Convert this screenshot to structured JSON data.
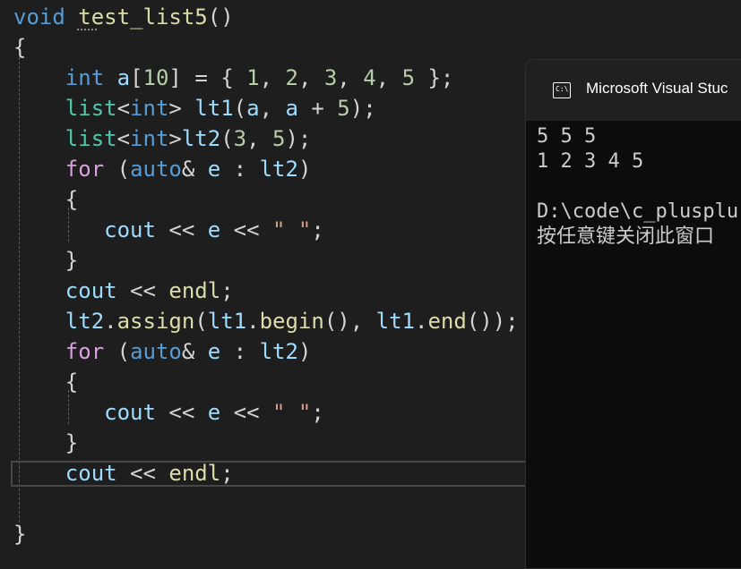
{
  "editor": {
    "lines": [
      {
        "id": "l1",
        "tokens": [
          {
            "t": "void",
            "c": "kw"
          },
          {
            "t": " ",
            "c": "punc"
          },
          {
            "t": "test_list5",
            "c": "fn"
          },
          {
            "t": "()",
            "c": "punc"
          }
        ]
      },
      {
        "id": "l2",
        "tokens": [
          {
            "t": "{",
            "c": "punc"
          }
        ]
      },
      {
        "id": "l3",
        "tokens": [
          {
            "t": "    int",
            "c": "kw"
          },
          {
            "t": " ",
            "c": "punc"
          },
          {
            "t": "a",
            "c": "var"
          },
          {
            "t": "[",
            "c": "punc"
          },
          {
            "t": "10",
            "c": "num"
          },
          {
            "t": "] = { ",
            "c": "punc"
          },
          {
            "t": "1",
            "c": "num"
          },
          {
            "t": ", ",
            "c": "punc"
          },
          {
            "t": "2",
            "c": "num"
          },
          {
            "t": ", ",
            "c": "punc"
          },
          {
            "t": "3",
            "c": "num"
          },
          {
            "t": ", ",
            "c": "punc"
          },
          {
            "t": "4",
            "c": "num"
          },
          {
            "t": ", ",
            "c": "punc"
          },
          {
            "t": "5",
            "c": "num"
          },
          {
            "t": " };",
            "c": "punc"
          }
        ]
      },
      {
        "id": "l4",
        "tokens": [
          {
            "t": "    list",
            "c": "typ"
          },
          {
            "t": "<",
            "c": "punc"
          },
          {
            "t": "int",
            "c": "kw"
          },
          {
            "t": "> ",
            "c": "punc"
          },
          {
            "t": "lt1",
            "c": "var"
          },
          {
            "t": "(",
            "c": "punc"
          },
          {
            "t": "a",
            "c": "var"
          },
          {
            "t": ", ",
            "c": "punc"
          },
          {
            "t": "a",
            "c": "var"
          },
          {
            "t": " + ",
            "c": "punc"
          },
          {
            "t": "5",
            "c": "num"
          },
          {
            "t": ");",
            "c": "punc"
          }
        ]
      },
      {
        "id": "l5",
        "tokens": [
          {
            "t": "    list",
            "c": "typ"
          },
          {
            "t": "<",
            "c": "punc"
          },
          {
            "t": "int",
            "c": "kw"
          },
          {
            "t": ">",
            "c": "punc"
          },
          {
            "t": "lt2",
            "c": "var"
          },
          {
            "t": "(",
            "c": "punc"
          },
          {
            "t": "3",
            "c": "num"
          },
          {
            "t": ", ",
            "c": "punc"
          },
          {
            "t": "5",
            "c": "num"
          },
          {
            "t": ");",
            "c": "punc"
          }
        ]
      },
      {
        "id": "l6",
        "tokens": [
          {
            "t": "    for",
            "c": "ctl"
          },
          {
            "t": " (",
            "c": "punc"
          },
          {
            "t": "auto",
            "c": "kw"
          },
          {
            "t": "& ",
            "c": "punc"
          },
          {
            "t": "e",
            "c": "var"
          },
          {
            "t": " : ",
            "c": "punc"
          },
          {
            "t": "lt2",
            "c": "var"
          },
          {
            "t": ")",
            "c": "punc"
          }
        ]
      },
      {
        "id": "l7",
        "tokens": [
          {
            "t": "    {",
            "c": "punc"
          }
        ]
      },
      {
        "id": "l8",
        "tokens": [
          {
            "t": "       cout",
            "c": "var"
          },
          {
            "t": " << ",
            "c": "punc"
          },
          {
            "t": "e",
            "c": "var"
          },
          {
            "t": " << ",
            "c": "punc"
          },
          {
            "t": "\" \"",
            "c": "str"
          },
          {
            "t": ";",
            "c": "punc"
          }
        ]
      },
      {
        "id": "l9",
        "tokens": [
          {
            "t": "    }",
            "c": "punc"
          }
        ]
      },
      {
        "id": "l10",
        "tokens": [
          {
            "t": "    cout",
            "c": "var"
          },
          {
            "t": " << ",
            "c": "punc"
          },
          {
            "t": "endl",
            "c": "fn"
          },
          {
            "t": ";",
            "c": "punc"
          }
        ]
      },
      {
        "id": "l11",
        "tokens": [
          {
            "t": "    lt2",
            "c": "var"
          },
          {
            "t": ".",
            "c": "punc"
          },
          {
            "t": "assign",
            "c": "fn"
          },
          {
            "t": "(",
            "c": "punc"
          },
          {
            "t": "lt1",
            "c": "var"
          },
          {
            "t": ".",
            "c": "punc"
          },
          {
            "t": "begin",
            "c": "fn"
          },
          {
            "t": "(), ",
            "c": "punc"
          },
          {
            "t": "lt1",
            "c": "var"
          },
          {
            "t": ".",
            "c": "punc"
          },
          {
            "t": "end",
            "c": "fn"
          },
          {
            "t": "());",
            "c": "punc"
          }
        ]
      },
      {
        "id": "l12",
        "tokens": [
          {
            "t": "    for",
            "c": "ctl"
          },
          {
            "t": " (",
            "c": "punc"
          },
          {
            "t": "auto",
            "c": "kw"
          },
          {
            "t": "& ",
            "c": "punc"
          },
          {
            "t": "e",
            "c": "var"
          },
          {
            "t": " : ",
            "c": "punc"
          },
          {
            "t": "lt2",
            "c": "var"
          },
          {
            "t": ")",
            "c": "punc"
          }
        ]
      },
      {
        "id": "l13",
        "tokens": [
          {
            "t": "    {",
            "c": "punc"
          }
        ]
      },
      {
        "id": "l14",
        "tokens": [
          {
            "t": "       cout",
            "c": "var"
          },
          {
            "t": " << ",
            "c": "punc"
          },
          {
            "t": "e",
            "c": "var"
          },
          {
            "t": " << ",
            "c": "punc"
          },
          {
            "t": "\" \"",
            "c": "str"
          },
          {
            "t": ";",
            "c": "punc"
          }
        ]
      },
      {
        "id": "l15",
        "tokens": [
          {
            "t": "    }",
            "c": "punc"
          }
        ]
      },
      {
        "id": "l16",
        "tokens": [
          {
            "t": "    cout",
            "c": "var"
          },
          {
            "t": " << ",
            "c": "punc"
          },
          {
            "t": "endl",
            "c": "fn"
          },
          {
            "t": ";",
            "c": "punc"
          }
        ]
      },
      {
        "id": "l17",
        "tokens": []
      },
      {
        "id": "l18",
        "tokens": [
          {
            "t": "}",
            "c": "punc"
          }
        ]
      }
    ]
  },
  "console": {
    "title": "Microsoft Visual Stuc",
    "icon_text": "C:\\",
    "output_line_1": "5 5 5",
    "output_line_2": "1 2 3 4 5",
    "output_line_3": "",
    "output_line_4": "D:\\code\\c_plusplu",
    "output_line_5": "按任意键关闭此窗口"
  }
}
